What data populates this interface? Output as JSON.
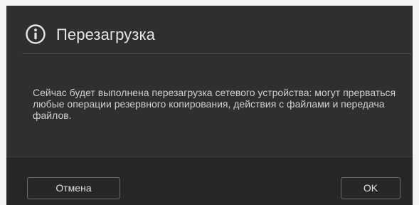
{
  "dialog": {
    "icon": "info-icon",
    "title": "Перезагрузка",
    "message": "Сейчас будет выполнена перезагрузка сетевого устройства: могут прерваться любые операции резервного копирования, действия с файлами и передача файлов."
  },
  "buttons": {
    "cancel_label": "Отмена",
    "ok_label": "OK"
  },
  "colors": {
    "dialog_background": "#2f2f2f",
    "footer_background": "#262626",
    "title_text": "#e6e6e6",
    "body_text": "#cfcfcf",
    "button_border": "#6d6d6d"
  }
}
